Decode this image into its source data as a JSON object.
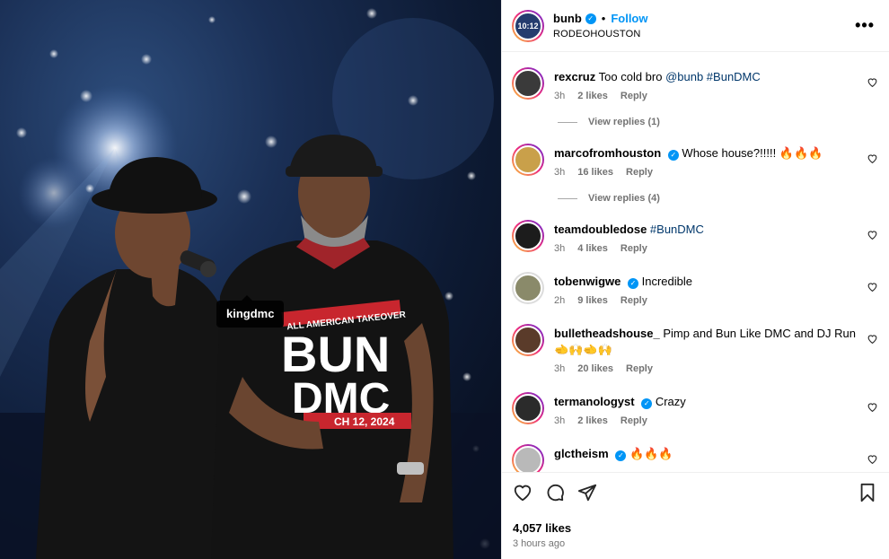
{
  "photo": {
    "tag_label": "kingdmc",
    "shirt_line1": "ALL AMERICAN TAKEOVER",
    "shirt_bun": "BUN",
    "shirt_dmc": "DMC",
    "shirt_date": "CH 12, 2024"
  },
  "post": {
    "username": "bunb",
    "follow_label": "Follow",
    "location": "RODEOHOUSTON",
    "more_label": "•••",
    "avatar_label": "10:12"
  },
  "comments": [
    {
      "user": "rexcruz",
      "verified": false,
      "text": "Too cold bro ",
      "tags": "@bunb #BunDMC",
      "time": "3h",
      "likes": "2 likes",
      "reply": "Reply",
      "view_replies": "View replies (1)",
      "avatar_color": "#3a3a3a"
    },
    {
      "user": "marcofromhouston",
      "verified": true,
      "text": "Whose house?!!!!! 🔥🔥🔥",
      "tags": "",
      "time": "3h",
      "likes": "16 likes",
      "reply": "Reply",
      "view_replies": "View replies (4)",
      "avatar_color": "#c9a04a"
    },
    {
      "user": "teamdoubledose",
      "verified": false,
      "text": "",
      "tags": "#BunDMC",
      "time": "3h",
      "likes": "4 likes",
      "reply": "Reply",
      "view_replies": "",
      "avatar_color": "#1c1c1c"
    },
    {
      "user": "tobenwigwe",
      "verified": true,
      "text": "Incredible",
      "tags": "",
      "time": "2h",
      "likes": "9 likes",
      "reply": "Reply",
      "view_replies": "",
      "avatar_color": "#8a8a6a"
    },
    {
      "user": "bulletheadshouse_",
      "verified": false,
      "text": "Pimp and Bun Like DMC and DJ Run 🫲🙌🫲🙌",
      "tags": "",
      "time": "3h",
      "likes": "20 likes",
      "reply": "Reply",
      "view_replies": "",
      "avatar_color": "#5a3b2a"
    },
    {
      "user": "termanologyst",
      "verified": true,
      "text": "Crazy",
      "tags": "",
      "time": "3h",
      "likes": "2 likes",
      "reply": "Reply",
      "view_replies": "",
      "avatar_color": "#2b2b2b"
    },
    {
      "user": "glctheism",
      "verified": true,
      "text": "🔥🔥🔥",
      "tags": "",
      "time": "",
      "likes": "",
      "reply": "",
      "view_replies": "",
      "avatar_color": "#b9b9b9"
    }
  ],
  "footer": {
    "likes": "4,057 likes",
    "time_ago": "3 hours ago"
  },
  "colors": {
    "accent": "#0095f6",
    "muted": "#737373",
    "tag": "#00376b"
  }
}
